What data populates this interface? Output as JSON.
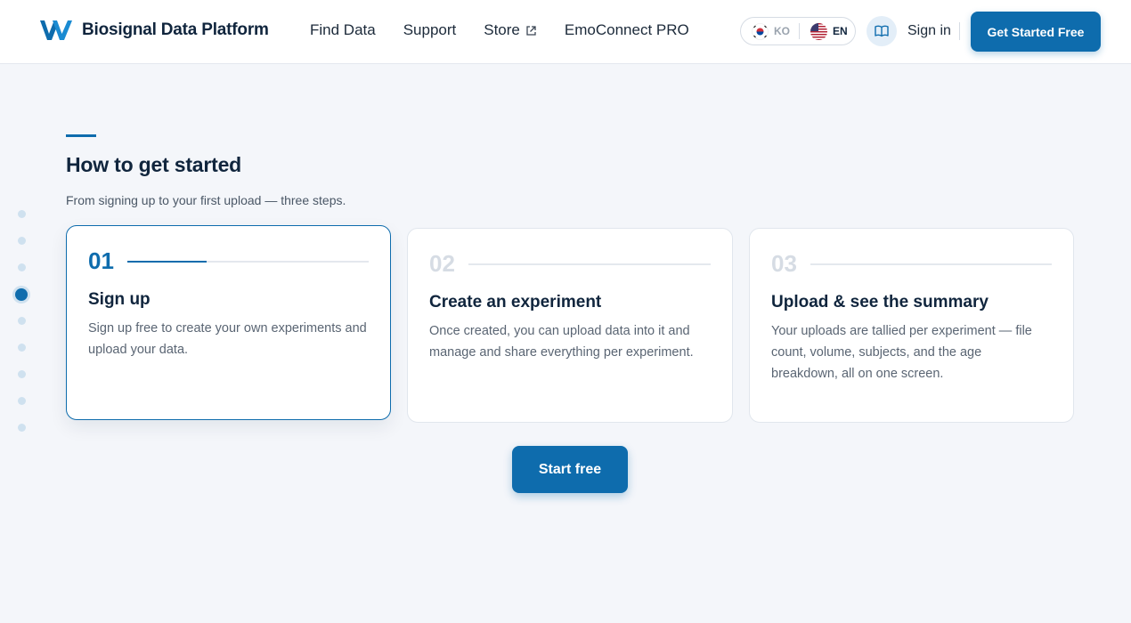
{
  "header": {
    "brand_name": "Biosignal Data Platform",
    "nav": [
      {
        "label": "Find Data"
      },
      {
        "label": "Support"
      },
      {
        "label": "Store",
        "icon": "external-link-icon"
      },
      {
        "label": "EmoConnect PRO"
      }
    ],
    "languages": [
      {
        "code": "KO",
        "icon": "korea-flag-icon",
        "selected": false
      },
      {
        "code": "EN",
        "icon": "us-flag-icon",
        "selected": true
      }
    ],
    "guide_icon": "book-icon",
    "sign_in_label": "Sign in",
    "cta_label": "Get Started Free"
  },
  "side_nav": {
    "dot_count": 9,
    "active_index": 3
  },
  "section": {
    "title": "How to get started",
    "subtitle": "From signing up to your first upload — three steps.",
    "steps": [
      {
        "number": "01",
        "title": "Sign up",
        "description": "Sign up free to create your own experiments and upload your data.",
        "active": true,
        "progress": 0.33
      },
      {
        "number": "02",
        "title": "Create an experiment",
        "description": "Once created, you can upload data into it and manage and share everything per experiment.",
        "active": false,
        "progress": 0
      },
      {
        "number": "03",
        "title": "Upload & see the summary",
        "description": "Your uploads are tallied per experiment — file count, volume, subjects, and the age breakdown, all on one screen.",
        "active": false,
        "progress": 0
      }
    ],
    "start_button_label": "Start free"
  },
  "colors": {
    "accent": "#0e6cad",
    "text_dark": "#10253d",
    "background": "#f4f6fa"
  }
}
